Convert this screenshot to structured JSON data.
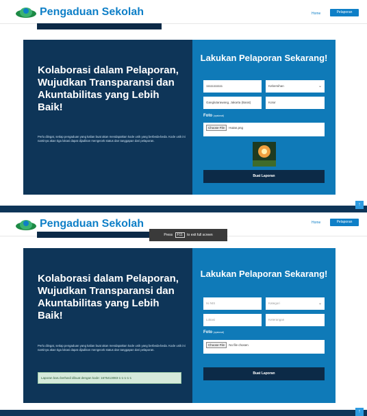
{
  "brand": {
    "name": "Pengaduan Sekolah"
  },
  "nav": {
    "home": "Home",
    "report": "Pelaporan"
  },
  "hero": {
    "title": "Kolaborasi dalam Pelaporan, Wujudkan Transparansi dan Akuntabilitas yang Lebih Baik!",
    "description": "Perlu diingat, setiap pengaduan yang kalian buat akan mendapatkan kode unik yang berbeda-beda. Kode unik ini nantinya akan tiga lokasi dapat dijadikan mengecek status dan tanggapan dari pelaporan."
  },
  "form": {
    "title": "Lakukan Pelaporan Sekarang!",
    "screen1": {
      "nis_value": "11111111111",
      "category_value": "Kebersihan",
      "location_value": "Ganglutarawang, Jakarta (Barat)",
      "description_value": "Kotor",
      "file_name": "Hutan.png"
    },
    "screen2": {
      "nis_placeholder": "Isi NIS",
      "category_placeholder": "Kategori",
      "location_placeholder": "Lokasi",
      "description_placeholder": "Keterangan",
      "file_name": "No file chosen"
    },
    "foto_label": "Foto",
    "foto_hint": "(opsional)",
    "choose_file": "Choose File",
    "submit": "Buat Laporan"
  },
  "fullscreen_toast": {
    "before": "Press",
    "key": "F11",
    "after": "to exit full screen"
  },
  "success_alert": "Laporan baru berhasil dibuat dengan kode: 1675413083-1-1-1-1-1",
  "scroll_top": "↑",
  "colors": {
    "navy": "#0e3558",
    "blue": "#0f7ab8",
    "brand": "#0e7fc7"
  }
}
